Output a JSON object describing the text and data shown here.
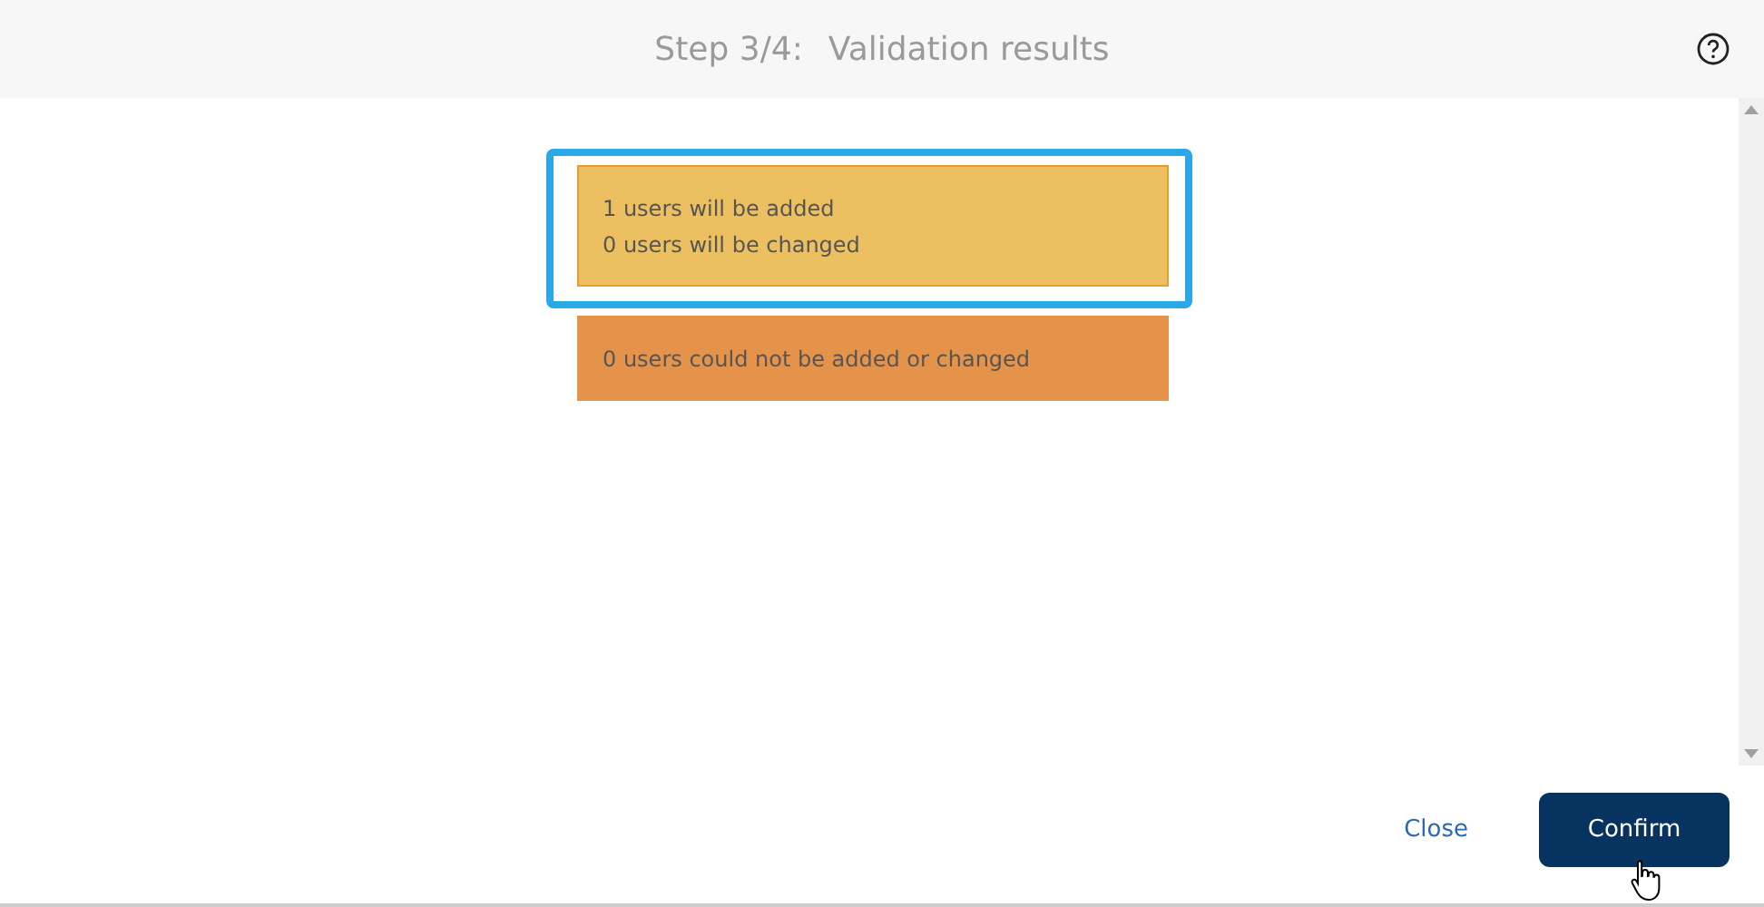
{
  "header": {
    "step": "Step 3/4:",
    "title": "Validation results"
  },
  "results": [
    {
      "kind": "pending",
      "focused": true,
      "lines": [
        "1 users will be added",
        "0 users will be changed"
      ]
    },
    {
      "kind": "failed",
      "focused": false,
      "lines": [
        "0 users could not be added or changed"
      ]
    }
  ],
  "footer": {
    "close": "Close",
    "confirm": "Confirm"
  }
}
